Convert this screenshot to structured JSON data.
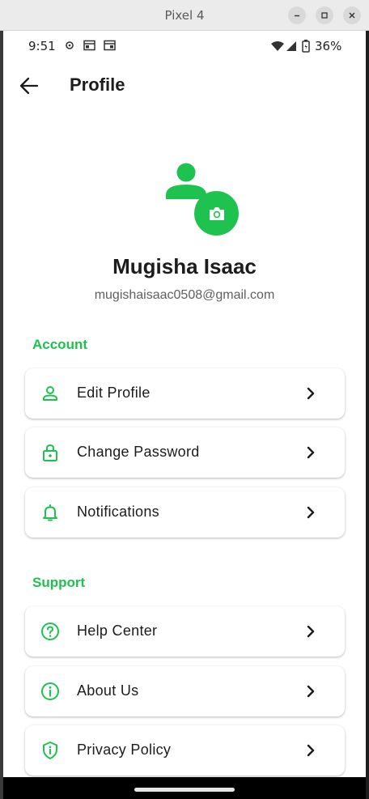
{
  "window": {
    "title": "Pixel 4",
    "controls": [
      "minimize",
      "maximize",
      "close"
    ]
  },
  "status_bar": {
    "time": "9:51",
    "battery": "36%",
    "icons": [
      "sync-icon",
      "notification-card-icon",
      "notification-card-icon",
      "wifi-icon",
      "signal-icon",
      "battery-icon"
    ]
  },
  "app_bar": {
    "back_icon": "arrow-back-icon",
    "title": "Profile"
  },
  "profile": {
    "name": "Mugisha Isaac",
    "email": "mugishaisaac0508@gmail.com",
    "avatar_icon": "person-icon",
    "badge_icon": "camera-icon"
  },
  "sections": {
    "account": {
      "title": "Account",
      "items": [
        {
          "label": "Edit Profile",
          "icon": "person-outline-icon"
        },
        {
          "label": "Change Password",
          "icon": "lock-icon"
        },
        {
          "label": "Notifications",
          "icon": "bell-icon"
        }
      ]
    },
    "support": {
      "title": "Support",
      "items": [
        {
          "label": "Help Center",
          "icon": "help-circle-icon"
        },
        {
          "label": "About Us",
          "icon": "info-icon"
        },
        {
          "label": "Privacy Policy",
          "icon": "shield-icon"
        }
      ]
    }
  },
  "colors": {
    "accent": "#1ec24f",
    "text": "#1c1c1c",
    "muted": "#606060",
    "background": "#ffffff"
  }
}
